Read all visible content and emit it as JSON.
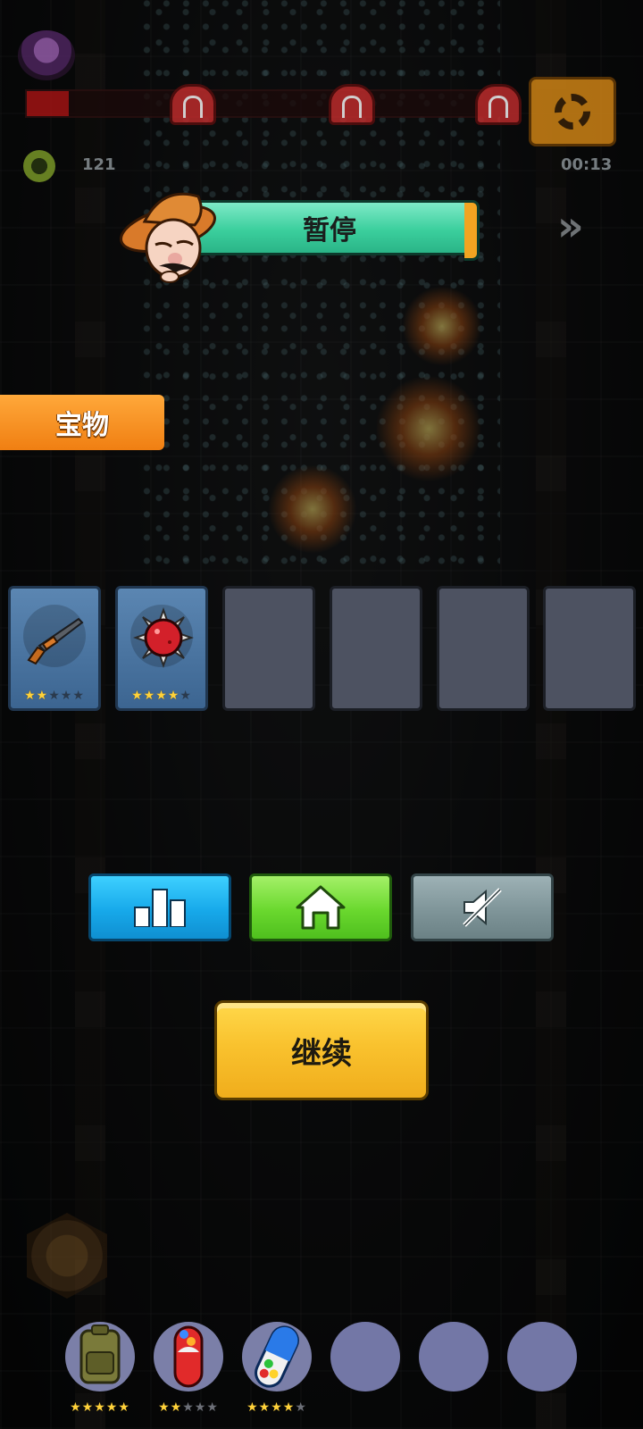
{
  "hud": {
    "kill_count": "121",
    "timer": "00:13",
    "boss_health": 0.09
  },
  "pause": {
    "title": "暂停"
  },
  "treasure": {
    "tab_label": "宝物",
    "slots": [
      {
        "item": "rifle-icon",
        "stars": 2,
        "max_stars": 5
      },
      {
        "item": "spiked-mine-icon",
        "stars": 4,
        "max_stars": 5
      },
      {
        "item": null
      },
      {
        "item": null
      },
      {
        "item": null
      },
      {
        "item": null
      }
    ]
  },
  "buttons": {
    "rank_icon": "bar-chart-icon",
    "home_icon": "home-icon",
    "sound_icon": "sound-off-icon",
    "continue_label": "继续"
  },
  "items": [
    {
      "item": "backpack-icon",
      "stars": 5,
      "max_stars": 5
    },
    {
      "item": "red-pill-icon",
      "stars": 2,
      "max_stars": 5
    },
    {
      "item": "blue-pill-icon",
      "stars": 4,
      "max_stars": 5
    },
    {
      "item": null
    },
    {
      "item": null
    },
    {
      "item": null
    }
  ],
  "colors": {
    "pause_banner": "#3bcf9d",
    "treasure_tab": "#f58a1f",
    "rank_button": "#17a9ea",
    "home_button": "#6ad82e",
    "sound_button": "#7f9599",
    "continue_button": "#f9c22e"
  }
}
